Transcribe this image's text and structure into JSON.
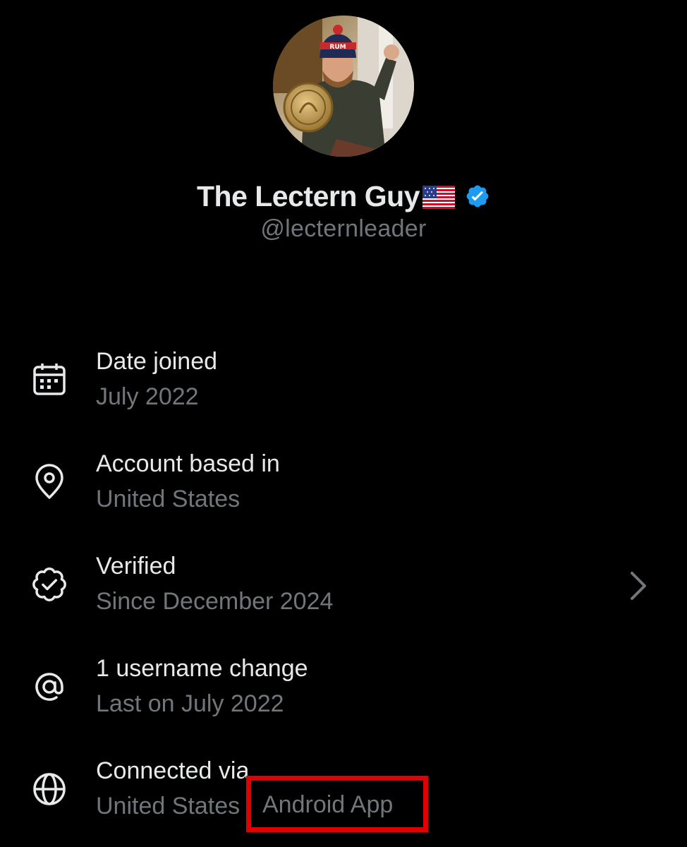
{
  "profile": {
    "display_name": "The Lectern Guy",
    "handle": "@lecternleader",
    "flag": "us-flag-emoji",
    "verified_badge_color": "#1d9bf0"
  },
  "about": {
    "rows": [
      {
        "icon": "calendar-icon",
        "title": "Date joined",
        "value": "July 2022"
      },
      {
        "icon": "location-pin-icon",
        "title": "Account based in",
        "value": "United States"
      },
      {
        "icon": "verified-badge-outline-icon",
        "title": "Verified",
        "value": "Since December 2024",
        "has_chevron": true
      },
      {
        "icon": "at-sign-icon",
        "title": "1 username change",
        "value": "Last on July 2022"
      },
      {
        "icon": "globe-icon",
        "title": "Connected via",
        "value": "United States",
        "highlighted_value": "Android App"
      }
    ]
  },
  "highlight": {
    "color": "#e00000"
  },
  "colors": {
    "background": "#000000",
    "primary_text": "#e7e9ea",
    "secondary_text": "#71767b"
  }
}
